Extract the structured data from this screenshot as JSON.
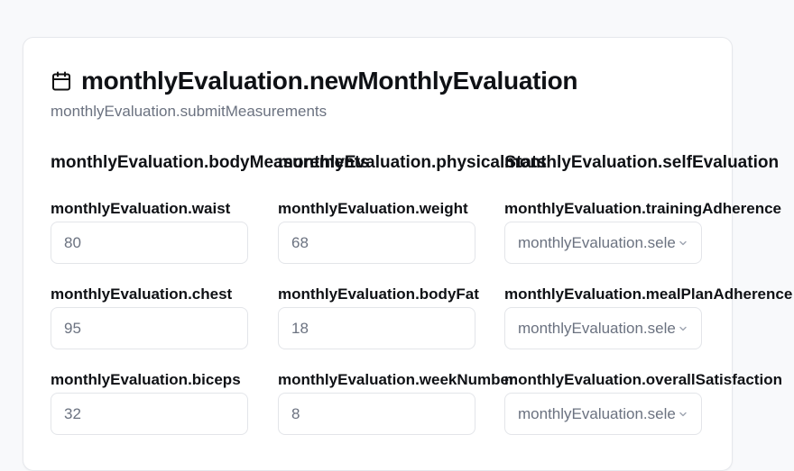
{
  "header": {
    "icon": "calendar-icon",
    "title": "monthlyEvaluation.newMonthlyEvaluation",
    "subtitle": "monthlyEvaluation.submitMeasurements"
  },
  "columns": [
    {
      "section_title": "monthlyEvaluation.bodyMeasurements",
      "fields": [
        {
          "label": "monthlyEvaluation.waist",
          "value": "80"
        },
        {
          "label": "monthlyEvaluation.chest",
          "value": "95"
        },
        {
          "label": "monthlyEvaluation.biceps",
          "value": "32"
        }
      ]
    },
    {
      "section_title": "monthlyEvaluation.physicalStats",
      "fields": [
        {
          "label": "monthlyEvaluation.weight",
          "value": "68"
        },
        {
          "label": "monthlyEvaluation.bodyFat",
          "value": "18"
        },
        {
          "label": "monthlyEvaluation.weekNumber",
          "value": "8"
        }
      ]
    },
    {
      "section_title": "monthlyEvaluation.selfEvaluation",
      "fields": [
        {
          "label": "monthlyEvaluation.trainingAdherence",
          "placeholder": "monthlyEvaluation.sele"
        },
        {
          "label": "monthlyEvaluation.mealPlanAdherence",
          "placeholder": "monthlyEvaluation.sele"
        },
        {
          "label": "monthlyEvaluation.overallSatisfaction",
          "placeholder": "monthlyEvaluation.sele"
        }
      ]
    }
  ]
}
